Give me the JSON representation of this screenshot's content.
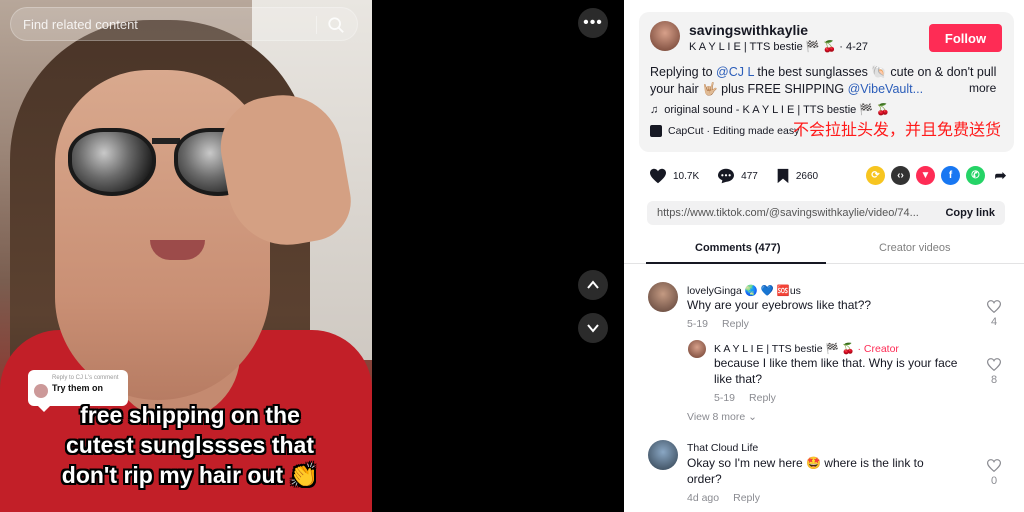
{
  "video": {
    "search_placeholder": "Find related content",
    "reply_bubble": {
      "small": "Reply to CJ L's comment",
      "bold": "Try them on"
    },
    "caption_lines": [
      "free shipping on the",
      "cutest sunglssses that",
      "don't rip my hair out 👏"
    ]
  },
  "nav": {
    "more": "•••"
  },
  "author": {
    "username": "savingswithkaylie",
    "subtitle": "K A Y L I E | TTS bestie 🏁 🍒 · 4-27",
    "follow_label": "Follow"
  },
  "description": {
    "prefix": "Replying to ",
    "mention1": "@CJ L",
    "middle": " the best sunglasses 🐚 cute on & don't pull your hair 🤟🏼 plus FREE SHIPPING ",
    "mention2": "@VibeVault...",
    "more": "more"
  },
  "sound": "original sound - K A Y L I E | TTS bestie 🏁 🍒",
  "capcut": "CapCut · Editing made easy",
  "overlay_cn": "不会拉扯头发，并且免费送货",
  "actions": {
    "likes": "10.7K",
    "comments": "477",
    "saves": "2660"
  },
  "share_colors": {
    "repost": "#f7c520",
    "embed": "#333333",
    "pinterest": "#fe2c55",
    "facebook": "#1877f2",
    "whatsapp": "#25d366"
  },
  "link": {
    "url": "https://www.tiktok.com/@savingswithkaylie/video/74...",
    "copy_label": "Copy link"
  },
  "tabs": {
    "comments": "Comments (477)",
    "creator_videos": "Creator videos"
  },
  "comments": [
    {
      "name": "lovelyGinga 🌏 💙 🆘us",
      "text": "Why are your eyebrows like that??",
      "date": "5-19",
      "reply": "Reply",
      "likes": "4"
    },
    {
      "name": "K A Y L I E | TTS bestie 🏁 🍒",
      "creator": "· Creator",
      "text": "because I like them like that. Why is your face like that?",
      "date": "5-19",
      "reply": "Reply",
      "likes": "8"
    },
    {
      "name": "That Cloud Life",
      "text": "Okay so I'm new here 🤩 where is the link to order?",
      "date": "4d ago",
      "reply": "Reply",
      "likes": "0"
    }
  ],
  "view_more": "View 8 more ⌄"
}
